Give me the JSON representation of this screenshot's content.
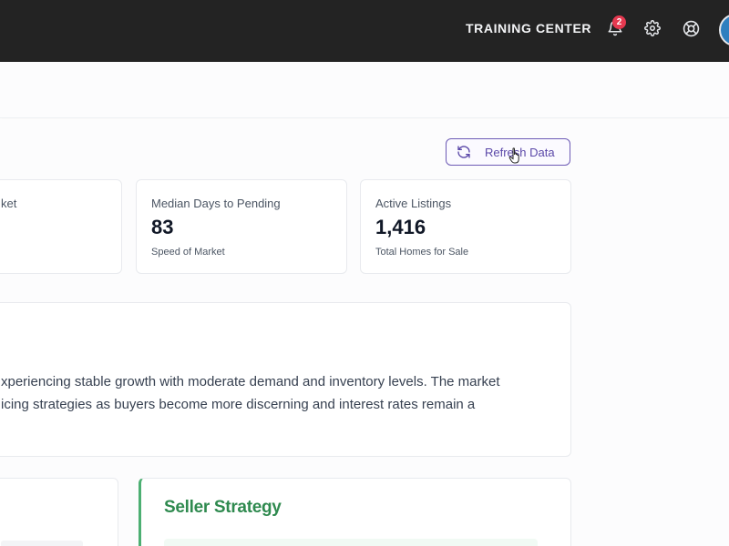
{
  "header": {
    "training_label": "TRAINING CENTER",
    "notification_count": "2",
    "icons": [
      "bell-icon",
      "gear-icon",
      "help-icon",
      "avatar"
    ]
  },
  "toolbar": {
    "refresh_label": "Refresh Data"
  },
  "stats": [
    {
      "label": "ket",
      "value": "",
      "sub": ""
    },
    {
      "label": "Median Days to Pending",
      "value": "83",
      "sub": "Speed of Market"
    },
    {
      "label": "Active Listings",
      "value": "1,416",
      "sub": "Total Homes for Sale"
    }
  ],
  "summary": {
    "line1": "xperiencing stable growth with moderate demand and inventory levels. The market",
    "line2": "icing strategies as buyers become more discerning and interest rates remain a"
  },
  "seller": {
    "title": "Seller Strategy"
  },
  "colors": {
    "topbar": "#232323",
    "accent": "#5a47a8",
    "badge": "#e53950",
    "seller_green": "#2f8a4f"
  }
}
